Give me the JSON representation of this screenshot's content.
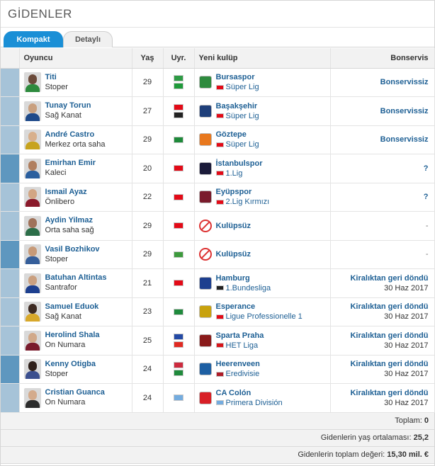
{
  "title": "GİDENLER",
  "tabs": [
    {
      "label": "Kompakt",
      "active": true
    },
    {
      "label": "Detaylı",
      "active": false
    }
  ],
  "columns": {
    "player": "Oyuncu",
    "age": "Yaş",
    "nationality": "Uyr.",
    "new_club": "Yeni kulüp",
    "fee": "Bonservis"
  },
  "rows": [
    {
      "name": "Titi",
      "position": "Stoper",
      "age": "29",
      "nationalities": [
        "#2e9b45",
        "#1f9a3a"
      ],
      "club": "Bursaspor",
      "league": "Süper Lig",
      "league_flag": "#e30a17",
      "fee": "Bonservissiz",
      "fee_date": ""
    },
    {
      "name": "Tunay Torun",
      "position": "Sağ Kanat",
      "age": "27",
      "nationalities": [
        "#e30a17",
        "#222"
      ],
      "club": "Başakşehir",
      "league": "Süper Lig",
      "league_flag": "#e30a17",
      "fee": "Bonservissiz",
      "fee_date": ""
    },
    {
      "name": "André Castro",
      "position": "Merkez orta saha",
      "age": "29",
      "nationalities": [
        "#1e8a3a"
      ],
      "club": "Göztepe",
      "league": "Süper Lig",
      "league_flag": "#e30a17",
      "fee": "Bonservissiz",
      "fee_date": ""
    },
    {
      "name": "Emirhan Emir",
      "position": "Kaleci",
      "age": "20",
      "nationalities": [
        "#e30a17"
      ],
      "club": "İstanbulspor",
      "league": "1.Lig",
      "league_flag": "#e30a17",
      "fee": "?",
      "fee_date": ""
    },
    {
      "name": "Ismail Ayaz",
      "position": "Önlibero",
      "age": "22",
      "nationalities": [
        "#e30a17"
      ],
      "club": "Eyüpspor",
      "league": "2.Lig Kırmızı",
      "league_flag": "#e30a17",
      "fee": "?",
      "fee_date": ""
    },
    {
      "name": "Aydin Yilmaz",
      "position": "Orta saha sağ",
      "age": "29",
      "nationalities": [
        "#e30a17"
      ],
      "club": "Kulüpsüz",
      "league": "",
      "league_flag": "",
      "fee": "-",
      "fee_date": ""
    },
    {
      "name": "Vasil Bozhikov",
      "position": "Stoper",
      "age": "29",
      "nationalities": [
        "#3d9a3d"
      ],
      "club": "Kulüpsüz",
      "league": "",
      "league_flag": "",
      "fee": "-",
      "fee_date": ""
    },
    {
      "name": "Batuhan Altintas",
      "position": "Santrafor",
      "age": "21",
      "nationalities": [
        "#e30a17"
      ],
      "club": "Hamburg",
      "league": "1.Bundesliga",
      "league_flag": "#222",
      "fee": "Kiralıktan geri döndü",
      "fee_date": "30 Haz 2017"
    },
    {
      "name": "Samuel Eduok",
      "position": "Sağ Kanat",
      "age": "23",
      "nationalities": [
        "#1f8a3c"
      ],
      "club": "Esperance",
      "league": "Ligue Professionelle 1",
      "league_flag": "#e30a17",
      "fee": "Kiralıktan geri döndü",
      "fee_date": "30 Haz 2017"
    },
    {
      "name": "Herolind Shala",
      "position": "On Numara",
      "age": "25",
      "nationalities": [
        "#244aa5",
        "#e02a22"
      ],
      "club": "Sparta Praha",
      "league": "HET Liga",
      "league_flag": "#d7141a",
      "fee": "Kiralıktan geri döndü",
      "fee_date": "30 Haz 2017"
    },
    {
      "name": "Kenny Otigba",
      "position": "Stoper",
      "age": "24",
      "nationalities": [
        "#cd2a3e",
        "#1f8a3c"
      ],
      "club": "Heerenveen",
      "league": "Eredivisie",
      "league_flag": "#ae1c28",
      "fee": "Kiralıktan geri döndü",
      "fee_date": "30 Haz 2017"
    },
    {
      "name": "Cristian Guanca",
      "position": "On Numara",
      "age": "24",
      "nationalities": [
        "#74acdf"
      ],
      "club": "CA Colón",
      "league": "Primera División",
      "league_flag": "#74acdf",
      "fee": "Kiralıktan geri döndü",
      "fee_date": "30 Haz 2017"
    }
  ],
  "summary": {
    "total_label": "Toplam:",
    "total_value": "0",
    "avg_age_label": "Gidenlerin yaş ortalaması:",
    "avg_age_value": "25,2",
    "total_value_label": "Gidenlerin toplam değeri:",
    "total_value_amount": "15,30 mil. €"
  },
  "colors": {
    "link": "#1d5f94",
    "tab_active": "#1a8fd6",
    "stripe_light": "#a6c3d8",
    "stripe_dark": "#5e97bf"
  }
}
